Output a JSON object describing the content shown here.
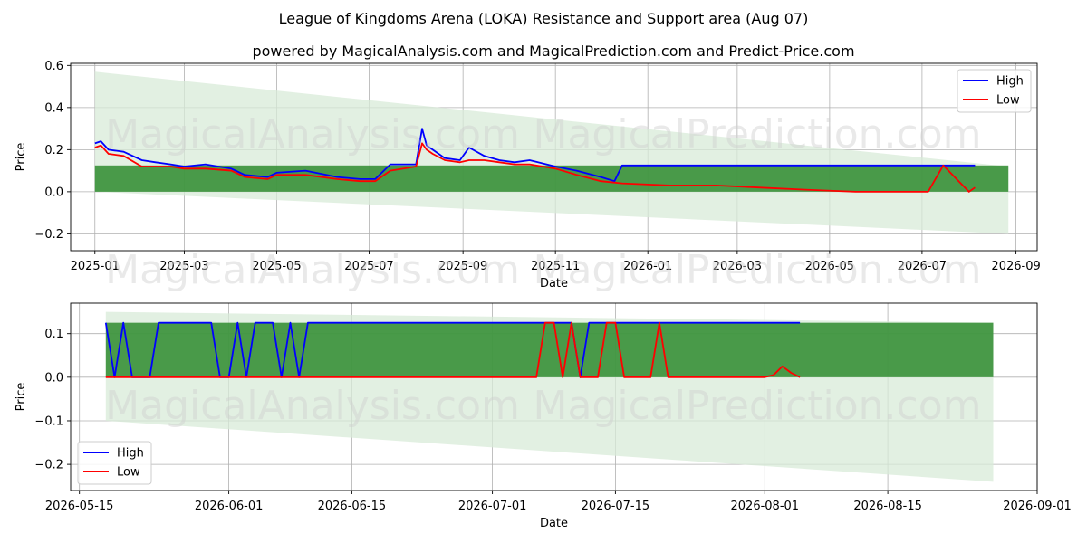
{
  "titles": {
    "main": "League of Kingdoms Arena (LOKA) Resistance and Support area (Aug 07)",
    "sub": "powered by MagicalAnalysis.com and MagicalPrediction.com and Predict-Price.com"
  },
  "watermarks": [
    "MagicalAnalysis.com",
    "MagicalPrediction.com"
  ],
  "colors": {
    "high": "#0000ff",
    "low": "#ff0000",
    "band_dark": "#2e8b2e",
    "band_light": "#d8ebd8"
  },
  "chart_data": [
    {
      "type": "line",
      "xlabel": "Date",
      "ylabel": "Price",
      "legend_position": "top-right",
      "grid": true,
      "xlim": [
        "2024-12-16",
        "2026-09-15"
      ],
      "ylim": [
        -0.28,
        0.61
      ],
      "x_ticks": [
        "2025-01",
        "2025-03",
        "2025-05",
        "2025-07",
        "2025-09",
        "2025-11",
        "2026-01",
        "2026-03",
        "2026-05",
        "2026-07",
        "2026-09"
      ],
      "y_ticks": [
        -0.2,
        0.0,
        0.2,
        0.4,
        0.6
      ],
      "y_tick_labels": [
        "−0.2",
        "0.0",
        "0.2",
        "0.4",
        "0.6"
      ],
      "support_band": {
        "x": [
          "2025-01-01",
          "2026-08-27"
        ],
        "lower": 0.0,
        "upper": 0.125
      },
      "prediction_band": {
        "x": [
          "2025-01-01",
          "2026-08-27"
        ],
        "upper": [
          0.57,
          0.12
        ],
        "lower": [
          0.0,
          -0.2
        ]
      },
      "series": [
        {
          "name": "High",
          "color": "#0000ff",
          "x": [
            "2025-01-01",
            "2025-01-05",
            "2025-01-10",
            "2025-01-20",
            "2025-02-01",
            "2025-02-10",
            "2025-02-20",
            "2025-03-01",
            "2025-03-15",
            "2025-04-01",
            "2025-04-10",
            "2025-04-25",
            "2025-05-01",
            "2025-05-20",
            "2025-06-10",
            "2025-06-25",
            "2025-07-05",
            "2025-07-15",
            "2025-08-01",
            "2025-08-05",
            "2025-08-08",
            "2025-08-12",
            "2025-08-20",
            "2025-08-30",
            "2025-09-05",
            "2025-09-15",
            "2025-09-25",
            "2025-10-05",
            "2025-10-15",
            "2025-11-01",
            "2025-11-15",
            "2025-12-01",
            "2025-12-10",
            "2025-12-15",
            "2026-01-15",
            "2026-02-15",
            "2026-03-15",
            "2026-04-15",
            "2026-05-18",
            "2026-06-15",
            "2026-07-15",
            "2026-08-05"
          ],
          "values": [
            0.23,
            0.24,
            0.2,
            0.19,
            0.15,
            0.14,
            0.13,
            0.12,
            0.13,
            0.11,
            0.08,
            0.07,
            0.09,
            0.1,
            0.07,
            0.06,
            0.06,
            0.13,
            0.13,
            0.3,
            0.22,
            0.2,
            0.16,
            0.15,
            0.21,
            0.17,
            0.15,
            0.14,
            0.15,
            0.12,
            0.1,
            0.07,
            0.05,
            0.125,
            0.125,
            0.125,
            0.125,
            0.125,
            0.125,
            0.125,
            0.125,
            0.125
          ]
        },
        {
          "name": "Low",
          "color": "#ff0000",
          "x": [
            "2025-01-01",
            "2025-01-05",
            "2025-01-10",
            "2025-01-20",
            "2025-02-01",
            "2025-02-10",
            "2025-02-20",
            "2025-03-01",
            "2025-03-15",
            "2025-04-01",
            "2025-04-10",
            "2025-04-25",
            "2025-05-01",
            "2025-05-20",
            "2025-06-10",
            "2025-06-25",
            "2025-07-05",
            "2025-07-15",
            "2025-08-01",
            "2025-08-05",
            "2025-08-08",
            "2025-08-12",
            "2025-08-20",
            "2025-08-30",
            "2025-09-05",
            "2025-09-15",
            "2025-09-25",
            "2025-10-05",
            "2025-10-15",
            "2025-11-01",
            "2025-11-15",
            "2025-12-01",
            "2025-12-15",
            "2026-01-15",
            "2026-02-15",
            "2026-03-15",
            "2026-04-15",
            "2026-05-18",
            "2026-06-15",
            "2026-07-05",
            "2026-07-15",
            "2026-08-01",
            "2026-08-05"
          ],
          "values": [
            0.21,
            0.22,
            0.18,
            0.17,
            0.12,
            0.12,
            0.12,
            0.11,
            0.11,
            0.1,
            0.07,
            0.06,
            0.08,
            0.08,
            0.06,
            0.05,
            0.05,
            0.1,
            0.12,
            0.23,
            0.2,
            0.18,
            0.15,
            0.14,
            0.15,
            0.15,
            0.14,
            0.13,
            0.13,
            0.11,
            0.08,
            0.05,
            0.04,
            0.03,
            0.03,
            0.02,
            0.01,
            0.0,
            0.0,
            0.0,
            0.125,
            0.0,
            0.02
          ]
        }
      ]
    },
    {
      "type": "line",
      "xlabel": "Date",
      "ylabel": "Price",
      "legend_position": "bottom-left",
      "grid": true,
      "xlim": [
        "2026-05-14",
        "2026-09-01"
      ],
      "ylim": [
        -0.26,
        0.17
      ],
      "x_ticks": [
        "2026-05-15",
        "2026-06-01",
        "2026-06-15",
        "2026-07-01",
        "2026-07-15",
        "2026-08-01",
        "2026-08-15",
        "2026-09-01"
      ],
      "y_ticks": [
        -0.2,
        -0.1,
        0.0,
        0.1
      ],
      "y_tick_labels": [
        "−0.2",
        "−0.1",
        "0.0",
        "0.1"
      ],
      "support_band": {
        "x": [
          "2026-05-18",
          "2026-08-27"
        ],
        "lower": 0.0,
        "upper": 0.125
      },
      "prediction_band": {
        "x": [
          "2026-05-18",
          "2026-08-27"
        ],
        "upper": [
          0.15,
          0.125
        ],
        "lower": [
          -0.1,
          -0.24
        ]
      },
      "series": [
        {
          "name": "High",
          "color": "#0000ff",
          "x": [
            "2026-05-18",
            "2026-05-19",
            "2026-05-20",
            "2026-05-21",
            "2026-05-22",
            "2026-05-23",
            "2026-05-24",
            "2026-05-30",
            "2026-05-31",
            "2026-06-01",
            "2026-06-02",
            "2026-06-03",
            "2026-06-04",
            "2026-06-06",
            "2026-06-07",
            "2026-06-08",
            "2026-06-09",
            "2026-06-10",
            "2026-06-11",
            "2026-07-10",
            "2026-07-11",
            "2026-07-12",
            "2026-07-13",
            "2026-08-05"
          ],
          "values": [
            0.125,
            0.0,
            0.125,
            0.0,
            0.0,
            0.0,
            0.125,
            0.125,
            0.0,
            0.0,
            0.125,
            0.0,
            0.125,
            0.125,
            0.0,
            0.125,
            0.0,
            0.125,
            0.125,
            0.125,
            0.0,
            0.125,
            0.125,
            0.125
          ]
        },
        {
          "name": "Low",
          "color": "#ff0000",
          "x": [
            "2026-05-18",
            "2026-07-06",
            "2026-07-07",
            "2026-07-08",
            "2026-07-09",
            "2026-07-10",
            "2026-07-11",
            "2026-07-12",
            "2026-07-13",
            "2026-07-14",
            "2026-07-15",
            "2026-07-16",
            "2026-07-19",
            "2026-07-20",
            "2026-07-21",
            "2026-08-01",
            "2026-08-02",
            "2026-08-03",
            "2026-08-04",
            "2026-08-05"
          ],
          "values": [
            0.0,
            0.0,
            0.125,
            0.125,
            0.0,
            0.125,
            0.0,
            0.0,
            0.0,
            0.125,
            0.125,
            0.0,
            0.0,
            0.125,
            0.0,
            0.0,
            0.005,
            0.025,
            0.01,
            0.0
          ]
        }
      ]
    }
  ]
}
